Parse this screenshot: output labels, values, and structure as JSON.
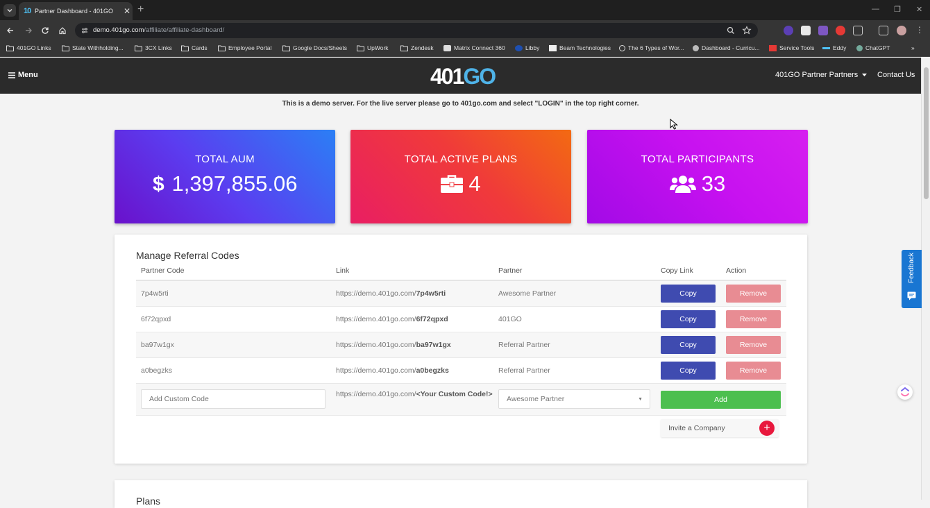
{
  "browser": {
    "tab_title": "Partner Dashboard - 401GO",
    "tab_favicon": "401GO",
    "url_host": "demo.401go.com",
    "url_path": "/affiliate/affiliate-dashboard/",
    "bookmarks": [
      "401GO Links",
      "State Withholding...",
      "3CX Links",
      "Cards",
      "Employee Portal",
      "Google Docs/Sheets",
      "UpWork",
      "Zendesk",
      "Matrix Connect 360",
      "Libby",
      "Beam Technologies",
      "The 6 Types of Wor...",
      "Dashboard - Curricu...",
      "Service Tools",
      "Eddy",
      "ChatGPT"
    ]
  },
  "header": {
    "menu_label": "Menu",
    "logo_part1": "401",
    "logo_part2": "GO",
    "partner_menu_label": "401GO Partner Partners",
    "contact_label": "Contact Us"
  },
  "notice": "This is a demo server. For the live server please go to 401go.com and select \"LOGIN\" in the top right corner.",
  "stats": {
    "aum": {
      "label": "TOTAL AUM",
      "value": "1,397,855.06",
      "icon": "dollar-icon"
    },
    "plans": {
      "label": "TOTAL ACTIVE PLANS",
      "value": "4",
      "icon": "briefcase-icon"
    },
    "participants": {
      "label": "TOTAL PARTICIPANTS",
      "value": "33",
      "icon": "users-icon"
    }
  },
  "referral": {
    "title": "Manage Referral Codes",
    "columns": [
      "Partner Code",
      "Link",
      "Partner",
      "Copy Link",
      "Action"
    ],
    "link_prefix": "https://demo.401go.com/",
    "rows": [
      {
        "code": "7p4w5rti",
        "partner": "Awesome Partner"
      },
      {
        "code": "6f72qpxd",
        "partner": "401GO"
      },
      {
        "code": "ba97w1gx",
        "partner": "Referral Partner"
      },
      {
        "code": "a0begzks",
        "partner": "Referral Partner"
      }
    ],
    "copy_label": "Copy",
    "remove_label": "Remove",
    "custom_placeholder": "Add Custom Code",
    "custom_link_prefix": "https://demo.401go.com/",
    "custom_link_code": "<Your Custom Code!>",
    "partner_select_value": "Awesome Partner",
    "add_label": "Add",
    "invite_label": "Invite a Company",
    "invite_plus": "+"
  },
  "plans_title": "Plans",
  "feedback_label": "Feedback",
  "colors": {
    "copy": "#3f4bb0",
    "remove": "#e88c93",
    "add": "#4cbf4f",
    "invite_plus": "#e8183d",
    "logo_accent": "#4fb3e8"
  }
}
